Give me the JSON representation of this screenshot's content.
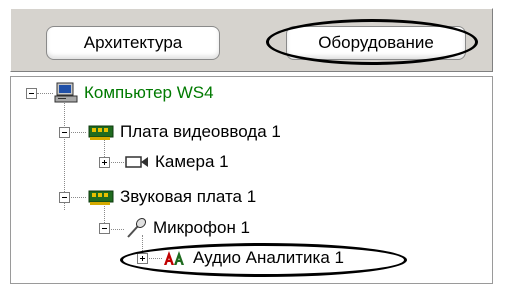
{
  "tabs": {
    "architecture_label": "Архитектура",
    "hardware_label": "Оборудование"
  },
  "tree": {
    "computer": "Компьютер WS4",
    "video_board": "Плата видеоввода 1",
    "camera": "Камера 1",
    "sound_board": "Звуковая плата 1",
    "microphone": "Микрофон 1",
    "audio_analytics": "Аудио Аналитика 1"
  },
  "icons": {
    "computer": "computer-icon",
    "video_board": "video-capture-board-icon",
    "camera": "camera-icon",
    "sound_board": "sound-card-icon",
    "microphone": "microphone-icon",
    "audio_analytics": "audio-analytics-icon"
  },
  "colors": {
    "computer_label": "#007a00",
    "audio_analytics_icon": "#c00000",
    "board_icon": "#1f6b1f"
  }
}
